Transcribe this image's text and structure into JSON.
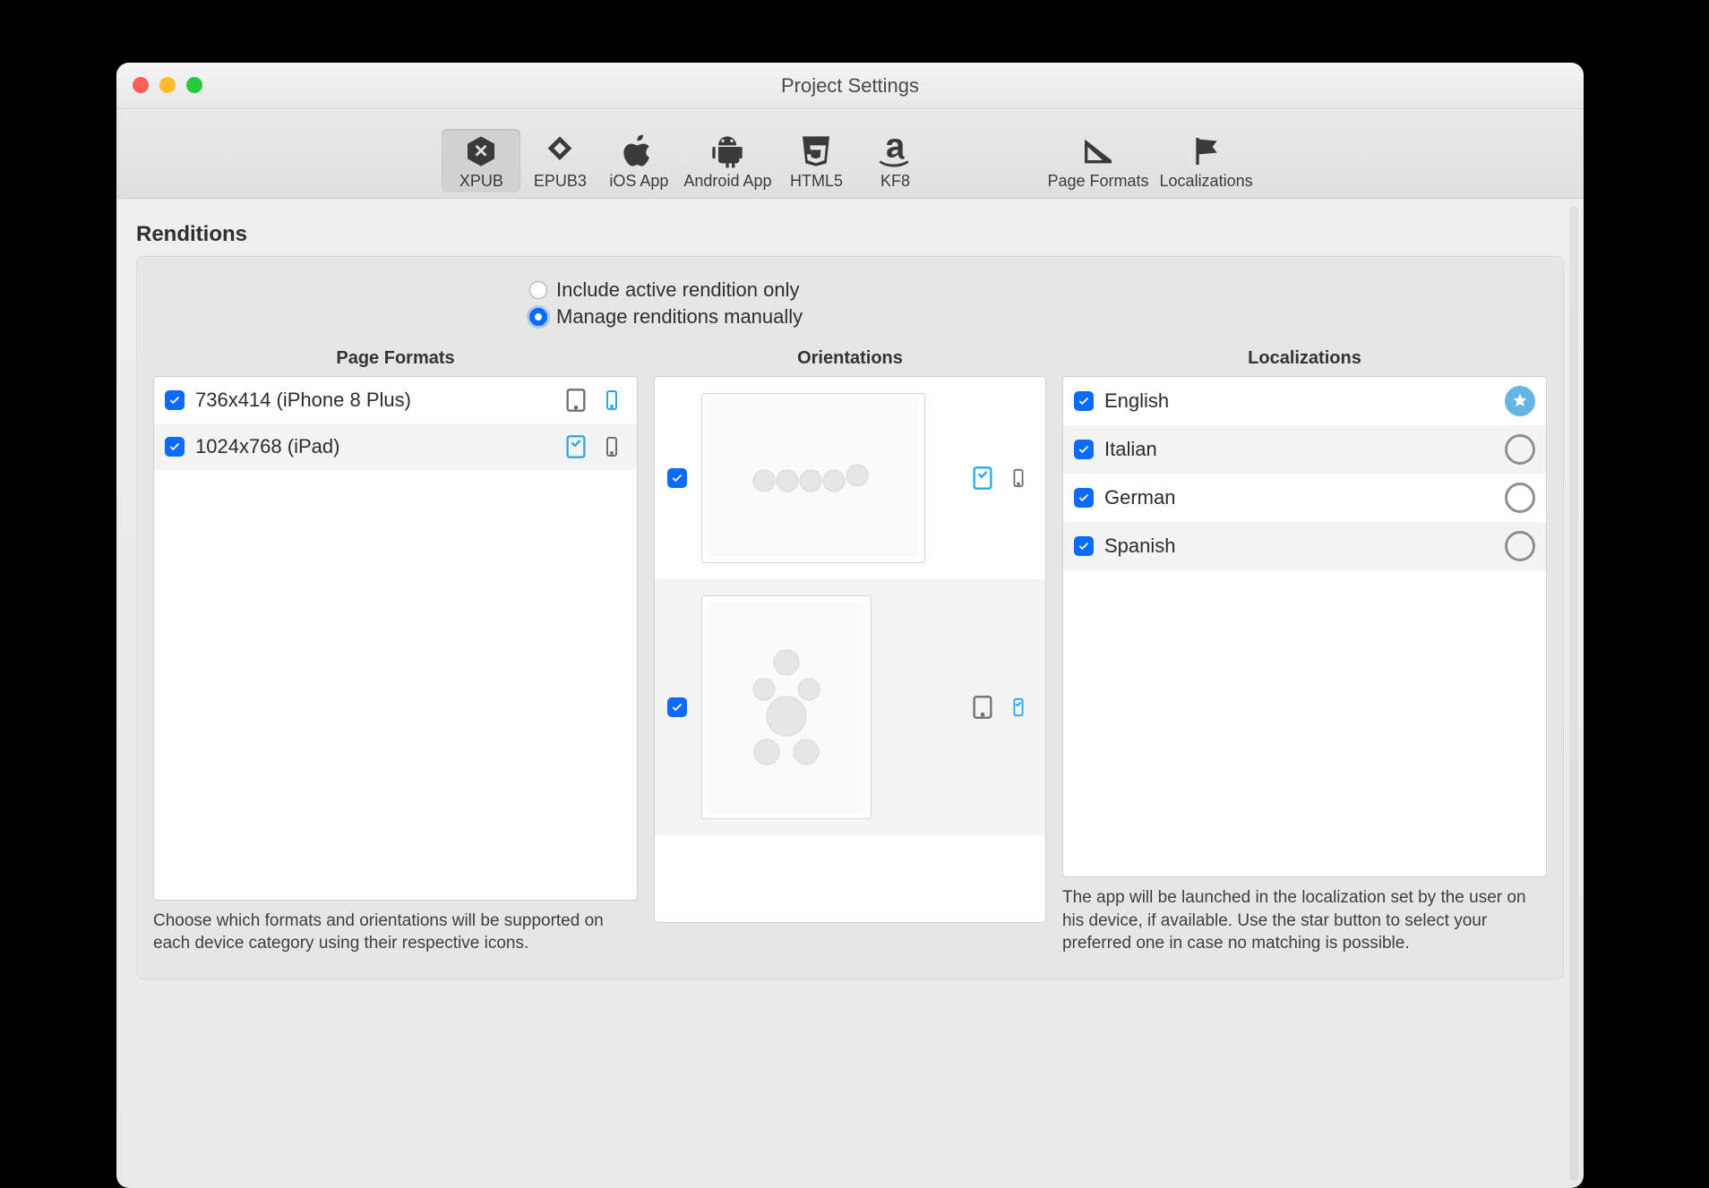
{
  "window": {
    "title": "Project Settings"
  },
  "toolbar": {
    "items": [
      {
        "label": "XPUB",
        "selected": true
      },
      {
        "label": "EPUB3"
      },
      {
        "label": "iOS App"
      },
      {
        "label": "Android App"
      },
      {
        "label": "HTML5"
      },
      {
        "label": "KF8"
      }
    ],
    "right_items": [
      {
        "label": "Page Formats"
      },
      {
        "label": "Localizations"
      }
    ]
  },
  "section": {
    "title": "Renditions"
  },
  "radios": {
    "include_label": "Include active rendition only",
    "manage_label": "Manage renditions manually",
    "selected": "manage"
  },
  "columns": {
    "page_formats_header": "Page Formats",
    "orientations_header": "Orientations",
    "localizations_header": "Localizations"
  },
  "page_formats": [
    {
      "checked": true,
      "label": "736x414 (iPhone 8 Plus)",
      "tablet": "dark",
      "phone": "lit"
    },
    {
      "checked": true,
      "label": "1024x768 (iPad)",
      "tablet": "lit",
      "phone": "dark"
    }
  ],
  "orientations": [
    {
      "checked": true,
      "shape": "horizontal",
      "tablet": "lit",
      "phone": "dark"
    },
    {
      "checked": true,
      "shape": "vertical",
      "tablet": "dark",
      "phone": "lit"
    }
  ],
  "localizations": [
    {
      "checked": true,
      "label": "English",
      "primary": true
    },
    {
      "checked": true,
      "label": "Italian",
      "primary": false
    },
    {
      "checked": true,
      "label": "German",
      "primary": false
    },
    {
      "checked": true,
      "label": "Spanish",
      "primary": false
    }
  ],
  "help": {
    "left": "Choose which formats and orientations will be supported on each device category using their respective icons.",
    "right": "The app will be launched in the localization set by the user on his device, if available. Use the star button to select your preferred one in case no matching is possible."
  }
}
